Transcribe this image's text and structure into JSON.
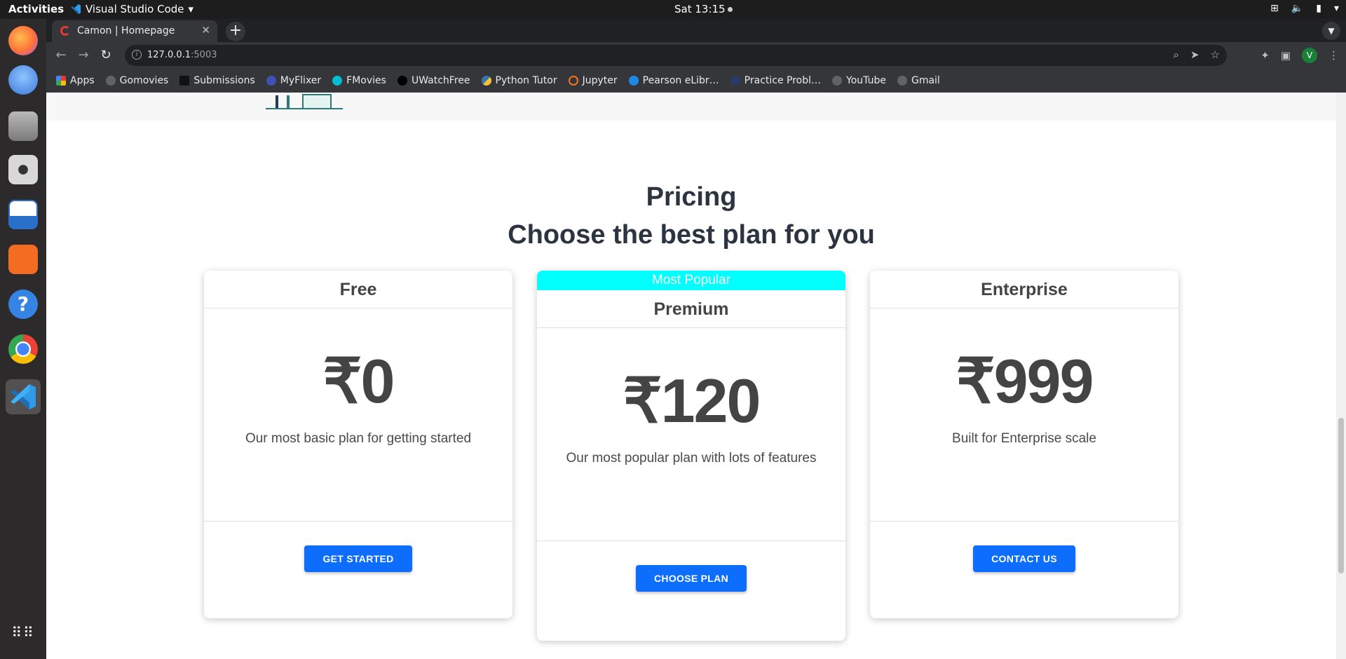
{
  "system_bar": {
    "activities": "Activities",
    "app_name": "Visual Studio Code",
    "clock": "Sat 13:15"
  },
  "dock": {
    "apps": [
      "firefox-icon",
      "thunderbird-icon",
      "files-icon",
      "rhythmbox-icon",
      "writer-icon",
      "software-icon",
      "help-icon",
      "chrome-icon",
      "vscode-icon"
    ],
    "colors": [
      "#ff7139",
      "#3b78d8",
      "#8a8a8a",
      "#d8d8d8",
      "#2a6fc9",
      "#f26d21",
      "#3584e4",
      "#4285f4",
      "#1f8ad2"
    ],
    "show_apps_icon": "grid-icon"
  },
  "browser": {
    "tab_title": "Camon | Homepage",
    "close_label": "✕",
    "new_tab_label": "+",
    "url_host": "127.0.0.1",
    "url_port": ":5003",
    "avatar_letter": "V"
  },
  "bookmarks": [
    {
      "label": "Apps",
      "color": "#e53935"
    },
    {
      "label": "Gomovies",
      "color": "#5f6368"
    },
    {
      "label": "Submissions",
      "color": "#111111"
    },
    {
      "label": "MyFlixer",
      "color": "#3f51b5"
    },
    {
      "label": "FMovies",
      "color": "#00bcd4"
    },
    {
      "label": "UWatchFree",
      "color": "#000000"
    },
    {
      "label": "Python Tutor",
      "color": "#fbc02d"
    },
    {
      "label": "Jupyter",
      "color": "#f37626"
    },
    {
      "label": "Pearson eLibr…",
      "color": "#1e88e5"
    },
    {
      "label": "Practice Probl…",
      "color": "#2b3a67"
    },
    {
      "label": "YouTube",
      "color": "#5f6368"
    },
    {
      "label": "Gmail",
      "color": "#5f6368"
    }
  ],
  "page": {
    "pre_heading": "Pricing",
    "heading": "Choose the best plan for you",
    "plans": [
      {
        "name": "Free",
        "price": "₹0",
        "description": "Our most basic plan for getting started",
        "button": "GET STARTED"
      },
      {
        "ribbon": "Most Popular",
        "name": "Premium",
        "price": "₹120",
        "description": "Our most popular plan with lots of features",
        "button": "CHOOSE PLAN"
      },
      {
        "name": "Enterprise",
        "price": "₹999",
        "description": "Built for Enterprise scale",
        "button": "CONTACT US"
      }
    ],
    "accent_color": "#0d6efd",
    "ribbon_color": "#00ffff"
  }
}
